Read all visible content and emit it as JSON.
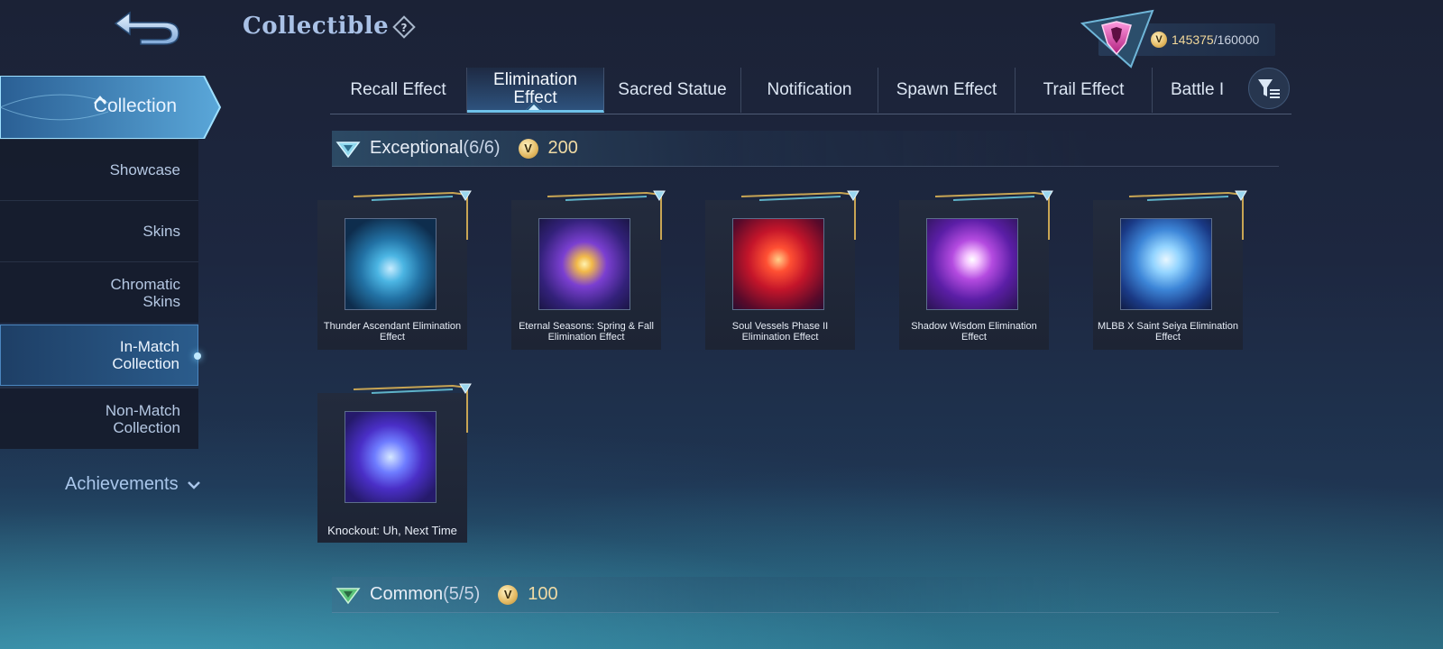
{
  "header": {
    "title": "Collectible",
    "currency_value": "145375",
    "currency_max": "/160000"
  },
  "sidebar": {
    "head_label": "Collection",
    "items": [
      {
        "label": "Showcase"
      },
      {
        "label": "Skins"
      },
      {
        "label": "Chromatic Skins"
      },
      {
        "label": "In-Match Collection"
      },
      {
        "label": "Non-Match Collection"
      }
    ],
    "achievements_label": "Achievements"
  },
  "tabs": [
    {
      "label": "Recall Effect"
    },
    {
      "label": "Elimination Effect",
      "active": true
    },
    {
      "label": "Sacred Statue"
    },
    {
      "label": "Notification"
    },
    {
      "label": "Spawn Effect"
    },
    {
      "label": "Trail Effect"
    },
    {
      "label": "Battle I"
    }
  ],
  "sections": [
    {
      "name": "Exceptional",
      "count": "(6/6)",
      "price": "200",
      "items": [
        {
          "label": "Thunder Ascendant Elimination Effect",
          "icon": "thunder-effect-icon"
        },
        {
          "label": "Eternal Seasons: Spring & Fall Elimination Effect",
          "icon": "eternal-seasons-effect-icon"
        },
        {
          "label": "Soul Vessels Phase II Elimination Effect",
          "icon": "soul-vessels-effect-icon"
        },
        {
          "label": "Shadow Wisdom Elimination Effect",
          "icon": "shadow-wisdom-effect-icon"
        },
        {
          "label": "MLBB X Saint Seiya Elimination Effect",
          "icon": "saint-seiya-effect-icon"
        },
        {
          "label": "Knockout: Uh, Next Time",
          "icon": "knockout-effect-icon"
        }
      ]
    },
    {
      "name": "Common",
      "count": "(5/5)",
      "price": "100"
    }
  ]
}
